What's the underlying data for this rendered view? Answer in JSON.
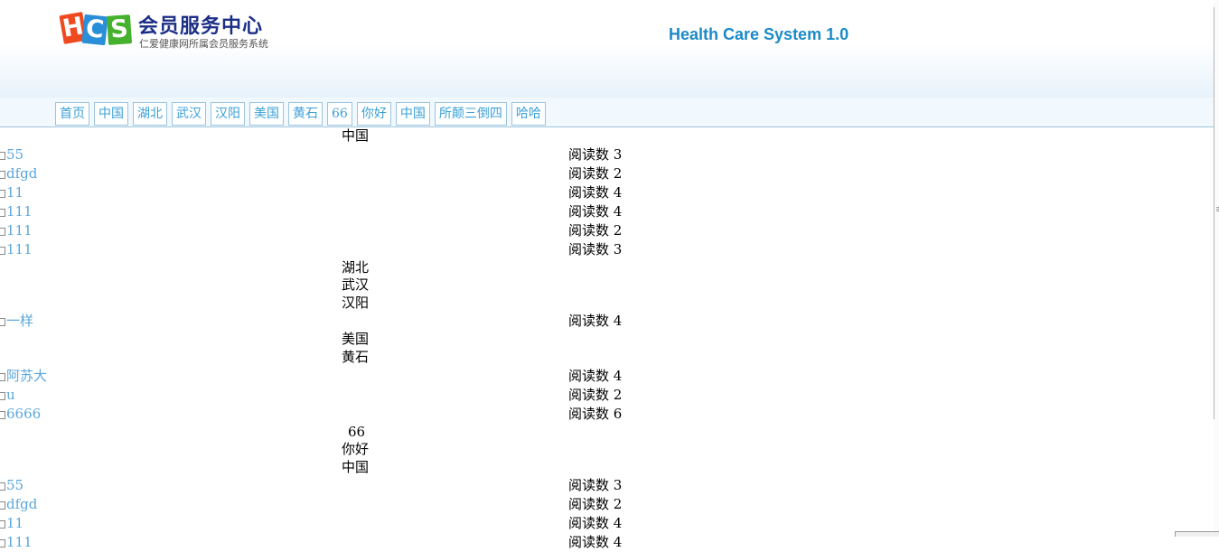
{
  "header": {
    "logo_letters": [
      "H",
      "C",
      "S"
    ],
    "logo_title": "会员服务中心",
    "logo_subtitle": "仁爱健康网所属会员服务系统",
    "system_title": "Health Care System 1.0"
  },
  "nav": [
    "首页",
    "中国",
    "湖北",
    "武汉",
    "汉阳",
    "美国",
    "黄石",
    "66",
    "你好",
    "中国",
    "所颠三倒四",
    "哈哈"
  ],
  "content": [
    {
      "type": "category",
      "name": "中国"
    },
    {
      "type": "article",
      "title": "55",
      "reads": "阅读数 3"
    },
    {
      "type": "article",
      "title": "dfgd",
      "reads": "阅读数 2"
    },
    {
      "type": "article",
      "title": "11",
      "reads": "阅读数 4"
    },
    {
      "type": "article",
      "title": "111",
      "reads": "阅读数 4"
    },
    {
      "type": "article",
      "title": "111",
      "reads": "阅读数 2"
    },
    {
      "type": "article",
      "title": "111",
      "reads": "阅读数 3"
    },
    {
      "type": "category",
      "name": "湖北"
    },
    {
      "type": "category",
      "name": "武汉"
    },
    {
      "type": "category",
      "name": "汉阳"
    },
    {
      "type": "article",
      "title": "一样",
      "reads": "阅读数 4"
    },
    {
      "type": "category",
      "name": "美国"
    },
    {
      "type": "category",
      "name": "黄石"
    },
    {
      "type": "article",
      "title": "阿苏大",
      "reads": "阅读数 4"
    },
    {
      "type": "article",
      "title": "u",
      "reads": "阅读数 2"
    },
    {
      "type": "article",
      "title": "6666",
      "reads": "阅读数 6"
    },
    {
      "type": "category",
      "name": "66"
    },
    {
      "type": "category",
      "name": "你好"
    },
    {
      "type": "category",
      "name": "中国"
    },
    {
      "type": "article",
      "title": "55",
      "reads": "阅读数 3"
    },
    {
      "type": "article",
      "title": "dfgd",
      "reads": "阅读数 2"
    },
    {
      "type": "article",
      "title": "11",
      "reads": "阅读数 4"
    },
    {
      "type": "article",
      "title": "111",
      "reads": "阅读数 4"
    }
  ],
  "colors": {
    "link": "#5aa6dd",
    "title_blue": "#1a8ac8",
    "logo_navy": "#1c2f86",
    "nav_border": "#9cc3dc"
  }
}
